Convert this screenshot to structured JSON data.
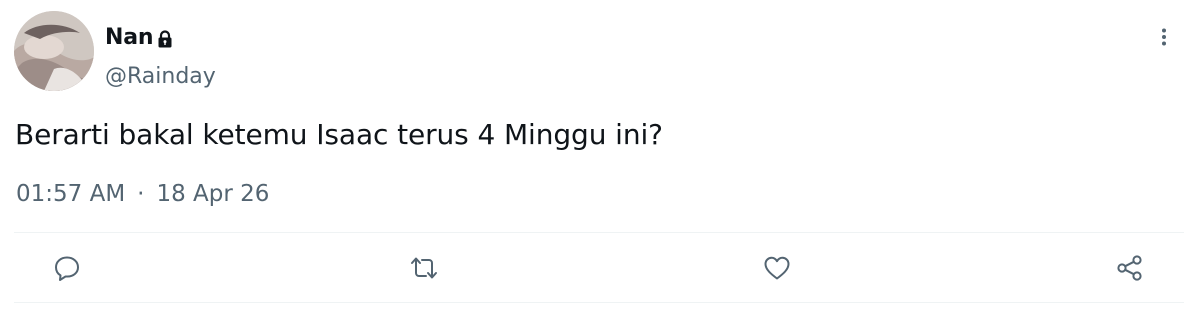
{
  "user": {
    "display_name": "Nan",
    "handle": "@Rainday",
    "protected_icon": "lock-icon"
  },
  "tweet": {
    "text": "Berarti bakal ketemu Isaac terus 4 Minggu ini?",
    "time": "01:57 AM",
    "separator": "·",
    "date": "18 Apr 26"
  },
  "actions": [
    {
      "name": "reply",
      "icon": "reply-icon"
    },
    {
      "name": "retweet",
      "icon": "retweet-icon"
    },
    {
      "name": "like",
      "icon": "heart-icon"
    },
    {
      "name": "share",
      "icon": "share-icon"
    }
  ],
  "colors": {
    "text_primary": "#0f1419",
    "text_secondary": "#536471",
    "divider": "#eff3f4",
    "icon": "#536471"
  }
}
